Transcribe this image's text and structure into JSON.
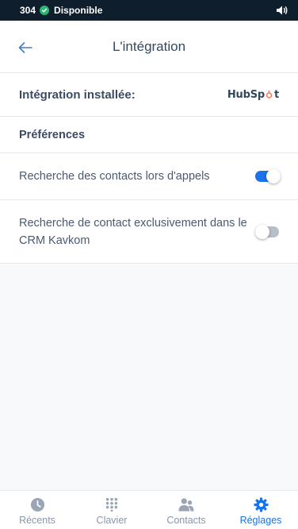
{
  "status": {
    "extension": "304",
    "availability": "Disponible",
    "available_color": "#2bb673"
  },
  "header": {
    "title": "L'intégration",
    "back_icon": "arrow-left-icon"
  },
  "integration": {
    "label": "Intégration installée:",
    "provider_logo_text": "HubSpot",
    "brand_color": "#ff7a59"
  },
  "preferences": {
    "heading": "Préférences",
    "items": [
      {
        "label": "Recherche des contacts lors d'appels",
        "enabled": true
      },
      {
        "label": "Recherche de contact exclusivement dans le CRM Kavkom",
        "enabled": false
      }
    ]
  },
  "nav": {
    "items": [
      {
        "label": "Récents",
        "icon": "clock-icon",
        "active": false
      },
      {
        "label": "Clavier",
        "icon": "keypad-icon",
        "active": false
      },
      {
        "label": "Contacts",
        "icon": "contacts-icon",
        "active": false
      },
      {
        "label": "Réglages",
        "icon": "gear-icon",
        "active": true
      }
    ]
  },
  "colors": {
    "accent": "#1a73e8",
    "status_bar_bg": "#0f1e2d",
    "inactive_icon": "#9aa6b5"
  }
}
